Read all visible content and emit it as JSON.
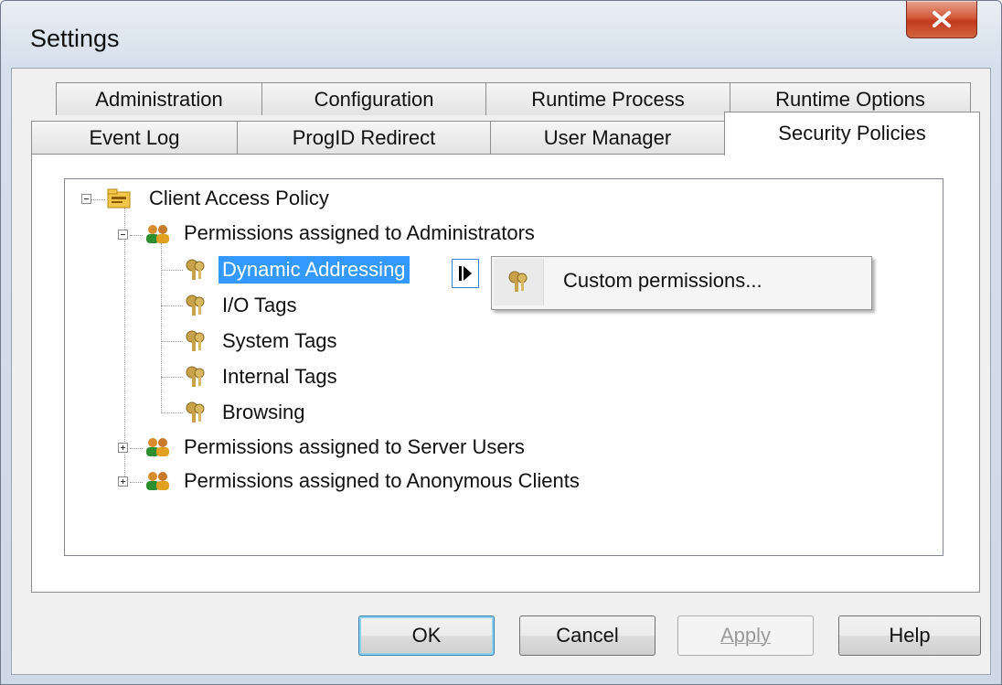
{
  "window": {
    "title": "Settings"
  },
  "tabs_row1": [
    "Administration",
    "Configuration",
    "Runtime Process",
    "Runtime Options"
  ],
  "tabs_row2": [
    "Event Log",
    "ProgID Redirect",
    "User Manager",
    "Security Policies"
  ],
  "active_tab": "Security Policies",
  "tree": {
    "root": "Client Access Policy",
    "group_admin": "Permissions assigned to Administrators",
    "admin_items": [
      "Dynamic Addressing",
      "I/O Tags",
      "System Tags",
      "Internal Tags",
      "Browsing"
    ],
    "group_server": "Permissions assigned to Server Users",
    "group_anon": "Permissions assigned to Anonymous Clients"
  },
  "context_menu": {
    "item": "Custom permissions..."
  },
  "buttons": {
    "ok": "OK",
    "cancel": "Cancel",
    "apply": "Apply",
    "help": "Help"
  },
  "colors": {
    "selection": "#3399ff",
    "close": "#c23a1e"
  },
  "icons": {
    "root": "folder-policy-icon",
    "group": "users-icon",
    "item": "keys-icon",
    "edit": "edit-arrow-icon"
  }
}
